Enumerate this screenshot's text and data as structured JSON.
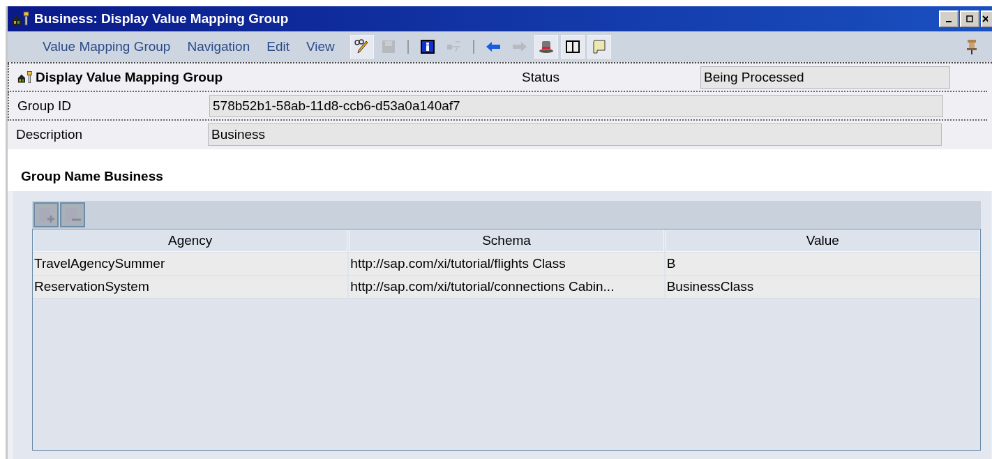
{
  "window": {
    "title": "Business: Display Value Mapping Group"
  },
  "menu": [
    "Value Mapping Group",
    "Navigation",
    "Edit",
    "View"
  ],
  "toolbar": [
    {
      "kind": "edit",
      "disabled": false
    },
    {
      "kind": "save",
      "disabled": true
    },
    {
      "kind": "sep"
    },
    {
      "kind": "info",
      "disabled": false
    },
    {
      "kind": "usage",
      "disabled": true
    },
    {
      "kind": "sep"
    },
    {
      "kind": "back",
      "disabled": false
    },
    {
      "kind": "forward",
      "disabled": true
    },
    {
      "kind": "hat",
      "disabled": false
    },
    {
      "kind": "book",
      "disabled": false
    },
    {
      "kind": "scroll",
      "disabled": false
    }
  ],
  "header": {
    "title": "Display Value Mapping Group",
    "status_label": "Status",
    "status_value": "Being Processed",
    "fields": [
      {
        "label": "Group ID",
        "value": "578b52b1-58ab-11d8-ccb6-d53a0a140af7"
      },
      {
        "label": "Description",
        "value": "Business"
      }
    ]
  },
  "group": {
    "title": "Group Name Business",
    "table": {
      "columns": [
        "Agency",
        "Schema",
        "Value"
      ],
      "rows": [
        [
          "TravelAgencySummer",
          "http://sap.com/xi/tutorial/flights Class",
          "B"
        ],
        [
          "ReservationSystem",
          "http://sap.com/xi/tutorial/connections Cabin...",
          "BusinessClass"
        ]
      ]
    }
  }
}
